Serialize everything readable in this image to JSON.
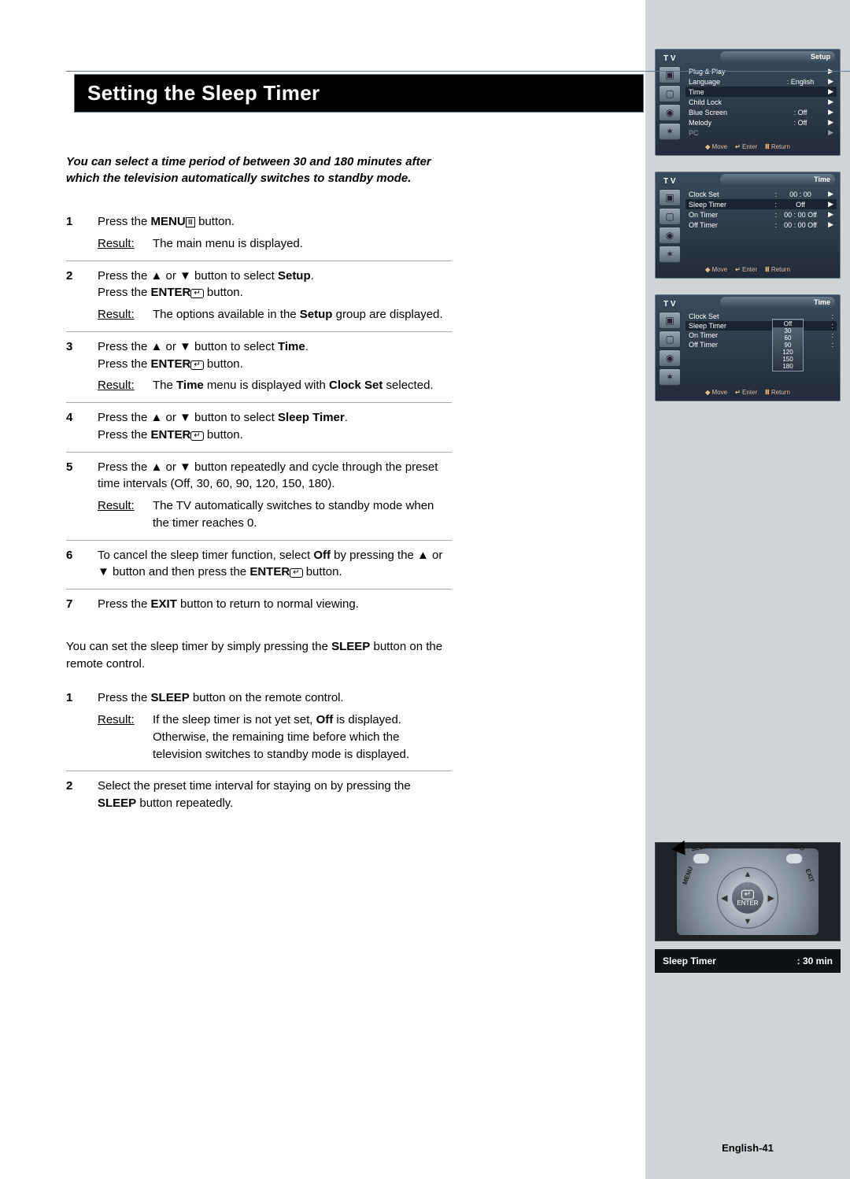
{
  "title": "Setting the Sleep Timer",
  "intro": "You can select a time period of between 30 and 180 minutes after which the television automatically switches to standby mode.",
  "steps": [
    {
      "num": "1",
      "parts": [
        "Press the ",
        "MENU",
        " button."
      ],
      "result": "The main menu is displayed."
    },
    {
      "num": "2",
      "parts": [
        "Press the ▲ or ▼ button to select ",
        "Setup",
        ".",
        " Press the ",
        "ENTER",
        " button."
      ],
      "result_parts": [
        "The options available in the ",
        "Setup",
        " group are displayed."
      ]
    },
    {
      "num": "3",
      "parts": [
        "Press the ▲ or ▼ button to select ",
        "Time",
        ".",
        " Press the ",
        "ENTER",
        " button."
      ],
      "result_parts": [
        "The ",
        "Time",
        " menu is displayed with ",
        "Clock Set",
        " selected."
      ]
    },
    {
      "num": "4",
      "parts": [
        "Press the ▲ or ▼ button to select ",
        "Sleep Timer",
        ".",
        " Press the ",
        "ENTER",
        " button."
      ]
    },
    {
      "num": "5",
      "text": "Press the ▲ or ▼ button repeatedly and cycle through the preset time intervals (Off, 30, 60,  90, 120, 150, 180).",
      "result": "The TV automatically switches to standby mode when the timer reaches 0."
    },
    {
      "num": "6",
      "parts": [
        "To cancel the sleep timer function, select ",
        "Off",
        " by pressing the ▲ or ▼ button and then press the ",
        "ENTER",
        " button."
      ]
    },
    {
      "num": "7",
      "parts": [
        "Press the ",
        "EXIT",
        " button to return to normal viewing."
      ]
    }
  ],
  "note_parts": [
    "You can set the sleep timer by simply pressing the ",
    "SLEEP",
    " button on the remote control."
  ],
  "alt_steps": [
    {
      "num": "1",
      "parts": [
        "Press the ",
        "SLEEP",
        " button on the remote control."
      ],
      "result_parts": [
        "If the sleep timer is not yet set, ",
        "Off",
        " is displayed. Otherwise, the remaining time before which the television switches to standby mode is displayed."
      ]
    },
    {
      "num": "2",
      "parts2": [
        "Select the preset time interval for staying on by pressing the ",
        "SLEEP",
        " button repeatedly."
      ]
    }
  ],
  "result_label": "Result:",
  "osd": {
    "tv": "T V",
    "setup_title": "Setup",
    "time_title": "Time",
    "foot_move": "Move",
    "foot_enter": "Enter",
    "foot_return": "Return",
    "panel1": [
      {
        "name": "Plug & Play",
        "val": "",
        "arr": "▶"
      },
      {
        "name": "Language",
        "val": ": English",
        "arr": "▶"
      },
      {
        "name": "Time",
        "val": "",
        "arr": "▶",
        "sel": true
      },
      {
        "name": "Child Lock",
        "val": "",
        "arr": "▶"
      },
      {
        "name": "Blue Screen",
        "val": ": Off",
        "arr": "▶"
      },
      {
        "name": "Melody",
        "val": ": Off",
        "arr": "▶"
      },
      {
        "name": "PC",
        "val": "",
        "arr": "▶",
        "dim": true
      }
    ],
    "panel2": [
      {
        "name": "Clock Set",
        "val": "00 : 00",
        "arr": "▶"
      },
      {
        "name": "Sleep Timer",
        "val": "Off",
        "arr": "▶",
        "sel": true
      },
      {
        "name": "On Timer",
        "val": "00 : 00    Off",
        "arr": "▶"
      },
      {
        "name": "Off Timer",
        "val": "00 : 00    Off",
        "arr": "▶"
      }
    ],
    "panel3": [
      {
        "name": "Clock Set",
        "val": "",
        "arr": ""
      },
      {
        "name": "Sleep Timer",
        "val": "",
        "arr": "",
        "sel": true
      },
      {
        "name": "On Timer",
        "val": "",
        "arr": ""
      },
      {
        "name": "Off Timer",
        "val": "",
        "arr": ""
      }
    ],
    "popup": [
      "Off",
      "30",
      "60",
      "90",
      "120",
      "150",
      "180"
    ],
    "popup_sel": "Off"
  },
  "remote": {
    "sleep": "SLEEP",
    "info": "INFO",
    "menu": "MENU",
    "exit": "EXIT",
    "enter": "ENTER"
  },
  "bar": {
    "label": "Sleep Timer",
    "value": ":  30 min"
  },
  "page": "English-41"
}
